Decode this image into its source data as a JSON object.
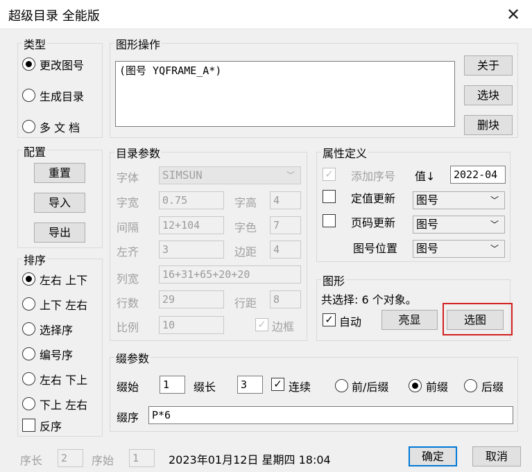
{
  "window": {
    "title": "超级目录 全能版",
    "close": "✕"
  },
  "type_group": {
    "label": "类型",
    "options": [
      "更改图号",
      "生成目录",
      "多 文 档"
    ]
  },
  "graphic_ops": {
    "label": "图形操作",
    "text": "(图号 YQFRAME_A*)",
    "buttons": [
      "关于",
      "选块",
      "删块"
    ]
  },
  "config": {
    "label": "配置",
    "buttons": [
      "重置",
      "导入",
      "导出"
    ]
  },
  "catalog": {
    "label": "目录参数",
    "font_label": "字体",
    "font_value": "SIMSUN",
    "width_label": "字宽",
    "width_value": "0.75",
    "height_label": "字高",
    "height_value": "4",
    "spacing_label": "间隔",
    "spacing_value": "12+104",
    "color_label": "字色",
    "color_value": "7",
    "align_label": "左齐",
    "align_value": "3",
    "margin_label": "边距",
    "margin_value": "4",
    "colw_label": "列宽",
    "colw_value": "16+31+65+20+20",
    "rows_label": "行数",
    "rows_value": "29",
    "rowgap_label": "行距",
    "rowgap_value": "8",
    "scale_label": "比例",
    "scale_value": "10",
    "border_label": "边框"
  },
  "attr": {
    "label": "属性定义",
    "add_seq": "添加序号",
    "value_label": "值↓",
    "value": "2022-04",
    "fixed_update": "定值更新",
    "fixed_combo": "图号",
    "page_update": "页码更新",
    "page_combo": "图号",
    "figno_pos": "图号位置",
    "figno_combo": "图号"
  },
  "shape": {
    "label": "图形",
    "selected": "共选择: 6 个对象。",
    "auto": "自动",
    "highlight": "亮显",
    "select": "选图"
  },
  "sort": {
    "label": "排序",
    "options": [
      "左右 上下",
      "上下 左右",
      "选择序",
      "编号序",
      "左右 下上",
      "下上 左右"
    ],
    "reverse": "反序"
  },
  "affix": {
    "label": "缀参数",
    "start_label": "缀始",
    "start_value": "1",
    "len_label": "缀长",
    "len_value": "3",
    "continuous": "连续",
    "options": [
      "前/后缀",
      "前缀",
      "后缀"
    ],
    "order_label": "缀序",
    "order_value": "P*6"
  },
  "footer": {
    "seqlen_label": "序长",
    "seqlen_value": "2",
    "seqstart_label": "序始",
    "seqstart_value": "1",
    "datetime": "2023年01月12日 星期四 18:04",
    "ok": "确定",
    "cancel": "取消"
  },
  "colors": {
    "highlight_box": "#d32020",
    "default_button": "#0078d7"
  }
}
